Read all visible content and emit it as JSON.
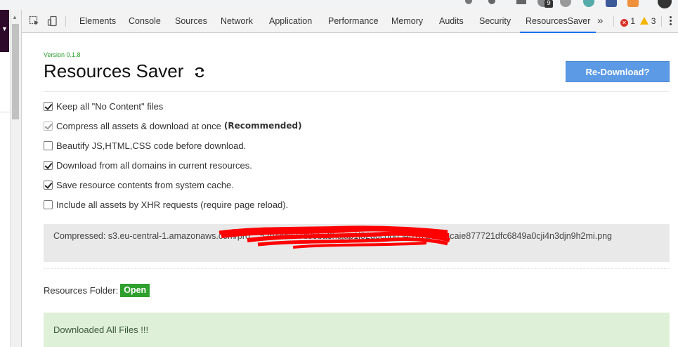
{
  "browser": {
    "extension_badge": "9"
  },
  "devtools": {
    "tabs": [
      {
        "label": "Elements"
      },
      {
        "label": "Console"
      },
      {
        "label": "Sources"
      },
      {
        "label": "Network"
      },
      {
        "label": "Application"
      },
      {
        "label": "Performance"
      },
      {
        "label": "Memory"
      },
      {
        "label": "Audits"
      },
      {
        "label": "Security"
      },
      {
        "label": "ResourcesSaver",
        "active": true
      }
    ],
    "error_count": "1",
    "warning_count": "3",
    "accent_color": "#1a73e8"
  },
  "panel": {
    "version": "Version 0.1.8",
    "title": "Resources Saver",
    "redownload_label": "Re-Download?",
    "options": [
      {
        "label": "Keep all \"No Content\" files",
        "checked": true,
        "disabled": false
      },
      {
        "label": "Compress all assets & download at once",
        "extra": "(Recommended)",
        "checked": true,
        "disabled": true
      },
      {
        "label": "Beautify JS,HTML,CSS code before download.",
        "checked": false,
        "disabled": false
      },
      {
        "label": "Download from all domains in current resources.",
        "checked": true,
        "disabled": false
      },
      {
        "label": "Save resource contents from system cache.",
        "checked": true,
        "disabled": false
      },
      {
        "label": "Include all assets by XHR requests (require page reload).",
        "checked": false,
        "disabled": false
      }
    ],
    "compressed_status": "Compressed: s3.eu-central-1.amazonaws.com/pro... 52h4cc837d85ba3hgjap1j52d0copg54j787a63aacaie877721dfc6849a0cji4n3djn9h2mi.png",
    "resources_folder_label": "Resources Folder:",
    "open_label": "Open",
    "downloaded_message": "Downloaded All Files !!!",
    "colors": {
      "button_blue": "#5c9ae6",
      "open_green": "#2ea02e",
      "success_bg": "#dff0d8",
      "version_green": "#2a9d2a",
      "redaction_red": "#ff0000"
    }
  }
}
